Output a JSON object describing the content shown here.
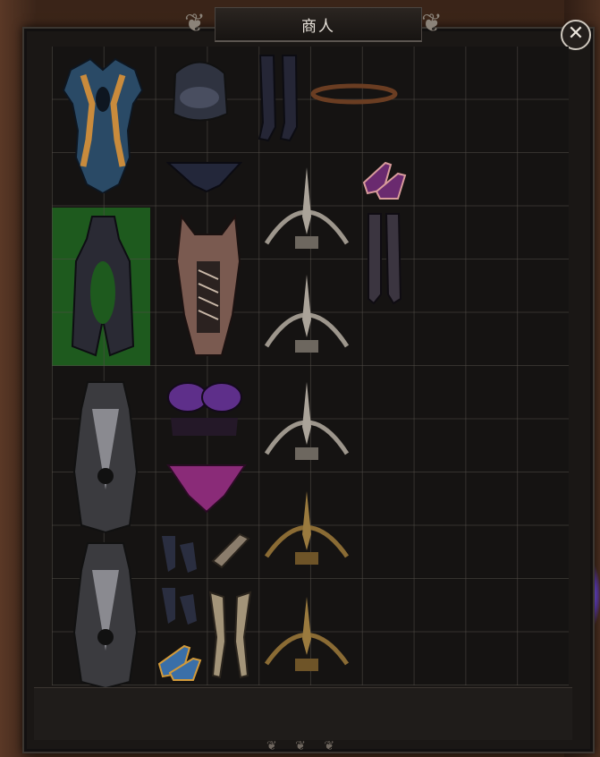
{
  "window": {
    "title": "商人",
    "close_label": "✕"
  },
  "inventory": {
    "highlight_color": "#1e5a1e",
    "items": [
      {
        "name": "blue-gold-bodysuit"
      },
      {
        "name": "dark-leather-top"
      },
      {
        "name": "dark-thong"
      },
      {
        "name": "thigh-boots"
      },
      {
        "name": "thorn-circlet"
      },
      {
        "name": "purple-heels"
      },
      {
        "name": "dark-cutout-dress"
      },
      {
        "name": "brown-laced-corset"
      },
      {
        "name": "spiked-crown-silver"
      },
      {
        "name": "laced-stockings"
      },
      {
        "name": "spiked-crown-silver-2"
      },
      {
        "name": "purple-bra"
      },
      {
        "name": "spiked-crown-silver-3"
      },
      {
        "name": "purple-panties"
      },
      {
        "name": "gray-corset-outfit"
      },
      {
        "name": "dark-gauntlets"
      },
      {
        "name": "spiked-crown-bronze"
      },
      {
        "name": "gray-corset-outfit-2"
      },
      {
        "name": "dark-gauntlets-2"
      },
      {
        "name": "tan-leg-guards"
      },
      {
        "name": "spiked-crown-bronze-2"
      },
      {
        "name": "blue-heels"
      }
    ]
  }
}
